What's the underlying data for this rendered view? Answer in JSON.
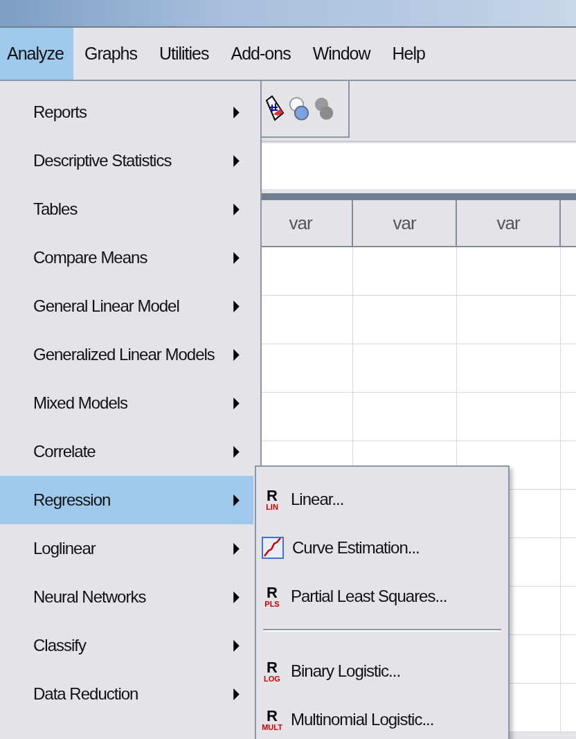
{
  "menubar": [
    {
      "label": "Analyze",
      "selected": true
    },
    {
      "label": "Graphs",
      "selected": false
    },
    {
      "label": "Utilities",
      "selected": false
    },
    {
      "label": "Add-ons",
      "selected": false
    },
    {
      "label": "Window",
      "selected": false
    },
    {
      "label": "Help",
      "selected": false
    }
  ],
  "grid": {
    "columns": [
      "var",
      "var",
      "var"
    ]
  },
  "analyze_menu": [
    {
      "label": "Reports",
      "has_submenu": true,
      "selected": false
    },
    {
      "label": "Descriptive Statistics",
      "has_submenu": true,
      "selected": false
    },
    {
      "label": "Tables",
      "has_submenu": true,
      "selected": false
    },
    {
      "label": "Compare Means",
      "has_submenu": true,
      "selected": false
    },
    {
      "label": "General Linear Model",
      "has_submenu": true,
      "selected": false
    },
    {
      "label": "Generalized Linear Models",
      "has_submenu": true,
      "selected": false
    },
    {
      "label": "Mixed Models",
      "has_submenu": true,
      "selected": false
    },
    {
      "label": "Correlate",
      "has_submenu": true,
      "selected": false
    },
    {
      "label": "Regression",
      "has_submenu": true,
      "selected": true
    },
    {
      "label": "Loglinear",
      "has_submenu": true,
      "selected": false
    },
    {
      "label": "Neural Networks",
      "has_submenu": true,
      "selected": false
    },
    {
      "label": "Classify",
      "has_submenu": true,
      "selected": false
    },
    {
      "label": "Data Reduction",
      "has_submenu": true,
      "selected": false
    }
  ],
  "regression_menu": [
    {
      "kind": "r-badge",
      "badge_letter": "R",
      "badge": "LIN",
      "label": "Linear..."
    },
    {
      "kind": "curve",
      "label": "Curve Estimation..."
    },
    {
      "kind": "r-badge",
      "badge_letter": "R",
      "badge": "PLS",
      "label": "Partial Least Squares..."
    },
    {
      "kind": "separator"
    },
    {
      "kind": "r-badge",
      "badge_letter": "R",
      "badge": "LOG",
      "label": "Binary Logistic..."
    },
    {
      "kind": "r-badge",
      "badge_letter": "R",
      "badge": "MULT",
      "label": "Multinomial Logistic..."
    }
  ]
}
